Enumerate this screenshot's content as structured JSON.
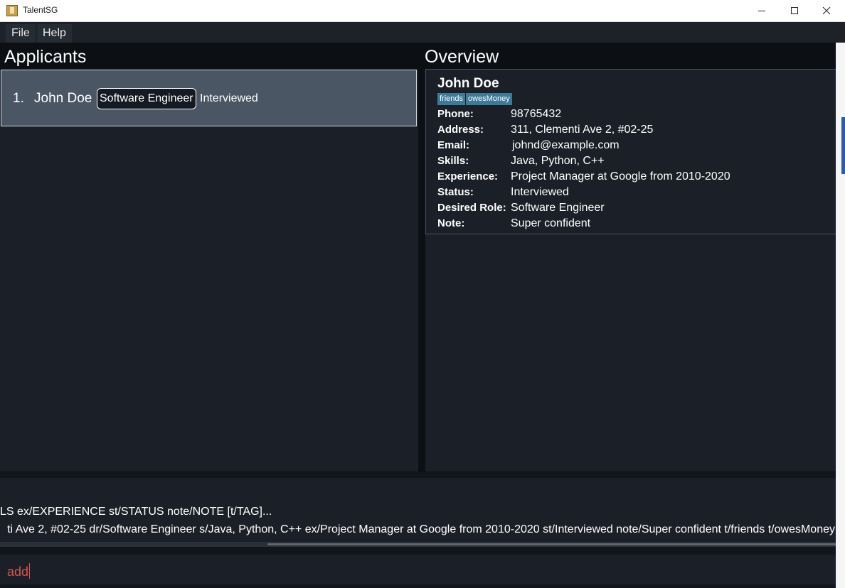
{
  "window": {
    "title": "TalentSG",
    "icons": {
      "app": "app-icon",
      "minimize": "minimize-icon",
      "maximize": "maximize-icon",
      "close": "close-icon"
    }
  },
  "menu": {
    "items": [
      "File",
      "Help"
    ]
  },
  "applicants": {
    "heading": "Applicants",
    "list": [
      {
        "index": "1.",
        "name": "John Doe",
        "role": "Software Engineer",
        "status": "Interviewed"
      }
    ]
  },
  "overview": {
    "heading": "Overview",
    "name": "John Doe",
    "tags": [
      "friends",
      "owesMoney"
    ],
    "fields": [
      {
        "label": "Phone:",
        "value": "98765432"
      },
      {
        "label": "Address:",
        "value": "311, Clementi Ave 2, #02-25"
      },
      {
        "label": "Email:",
        "value": "johnd@example.com"
      },
      {
        "label": "Skills:",
        "value": "Java, Python, C++"
      },
      {
        "label": "Experience:",
        "value": "Project Manager at Google from 2010-2020"
      },
      {
        "label": "Status:",
        "value": "Interviewed"
      },
      {
        "label": "Desired Role:",
        "value": "Software Engineer"
      },
      {
        "label": "Note:",
        "value": "Super confident"
      }
    ]
  },
  "result": {
    "line1": "LS ex/EXPERIENCE st/STATUS note/NOTE [t/TAG]...",
    "line2": "ti Ave 2, #02-25 dr/Software Engineer s/Java, Python, C++ ex/Project Manager at Google from 2010-2020 st/Interviewed note/Super confident t/friends t/owesMoney"
  },
  "command": {
    "value": "add"
  },
  "colors": {
    "accent_tag": "#3d7a9a",
    "command_text": "#d9534f",
    "selected_card": "#4b5665",
    "panel_bg": "#1b2028"
  }
}
